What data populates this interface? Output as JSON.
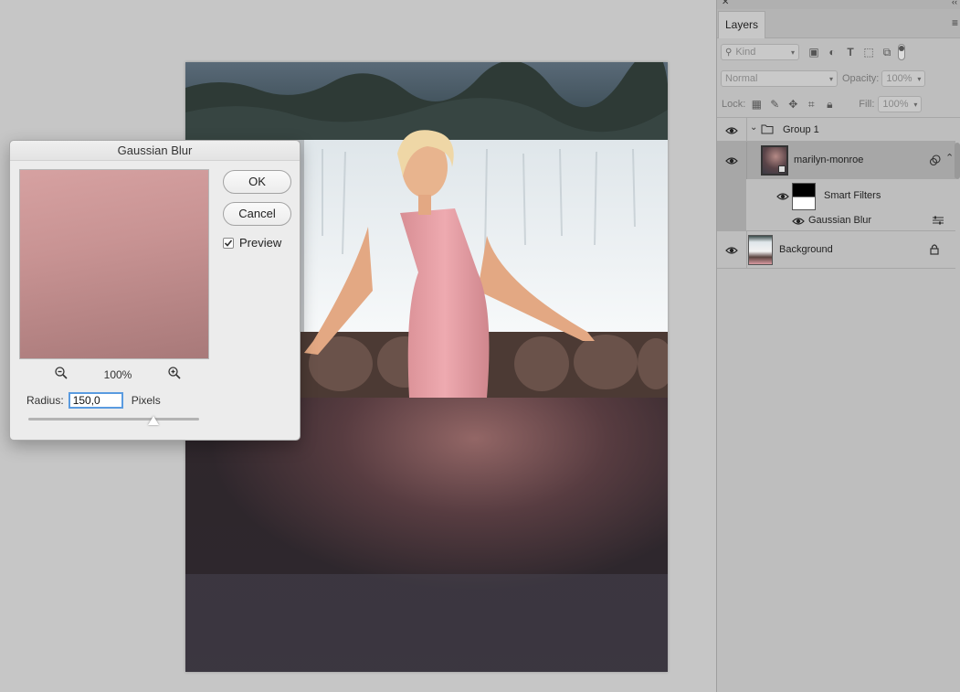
{
  "dialog": {
    "title": "Gaussian Blur",
    "ok_label": "OK",
    "cancel_label": "Cancel",
    "preview_label": "Preview",
    "preview_checked": true,
    "zoom_level": "100%",
    "radius_label": "Radius:",
    "radius_value": "150,0",
    "radius_unit": "Pixels",
    "slider_level": 0.735
  },
  "panel": {
    "tab_label": "Layers",
    "filter_kind": "Kind",
    "blend_mode": "Normal",
    "opacity_label": "Opacity:",
    "opacity_value": "100%",
    "lock_label": "Lock:",
    "fill_label": "Fill:",
    "fill_value": "100%",
    "layers": {
      "group": "Group 1",
      "smart_object": "marilyn-monroe",
      "smart_filters": "Smart Filters",
      "filter": "Gaussian Blur",
      "background": "Background"
    }
  },
  "colors": {
    "accent": "#5a9be0",
    "selected_layer": "#a7a7a7"
  }
}
